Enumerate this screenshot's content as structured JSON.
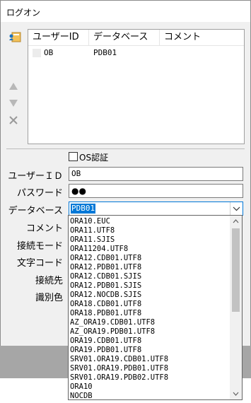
{
  "window": {
    "title": "ログオン"
  },
  "list": {
    "columns": [
      "ユーザーID",
      "データベース",
      "コメント"
    ],
    "rows": [
      {
        "user_id": "OB",
        "database": "PDB01",
        "comment": ""
      }
    ]
  },
  "form": {
    "os_auth_label": "OS認証",
    "user_id_label": "ユーザーＩＤ",
    "user_id_value": "OB",
    "password_label": "パスワード",
    "password_value": "●●",
    "database_label": "データベース",
    "database_value": "PDB01",
    "comment_label": "コメント",
    "connect_mode_label": "接続モード",
    "charset_label": "文字コード",
    "destination_label": "接続先",
    "color_label": "識別色"
  },
  "dropdown": {
    "options": [
      "ORA10.EUC",
      "ORA11.UTF8",
      "ORA11.SJIS",
      "ORA11204.UTF8",
      "ORA12.CDB01.UTF8",
      "ORA12.PDB01.UTF8",
      "ORA12.CDB01.SJIS",
      "ORA12.PDB01.SJIS",
      "ORA12.NOCDB.SJIS",
      "ORA18.CDB01.UTF8",
      "ORA18.PDB01.UTF8",
      "AZ_ORA19.CDB01.UTF8",
      "AZ_ORA19.PDB01.UTF8",
      "ORA19.CDB01.UTF8",
      "ORA19.PDB01.UTF8",
      "SRV01.ORA19.CDB01.UTF8",
      "SRV01.ORA19.PDB01.UTF8",
      "SRV01.ORA19.PDB02.UTF8",
      "ORA10",
      "NOCDB"
    ]
  },
  "icons": {
    "user": "user-icon",
    "up": "arrow-up-icon",
    "down": "arrow-down-icon",
    "delete": "delete-icon",
    "combo": "chevron-down-icon"
  },
  "colors": {
    "accent": "#0078d7",
    "icon_blue": "#1e73be",
    "icon_gold": "#f0a830"
  }
}
